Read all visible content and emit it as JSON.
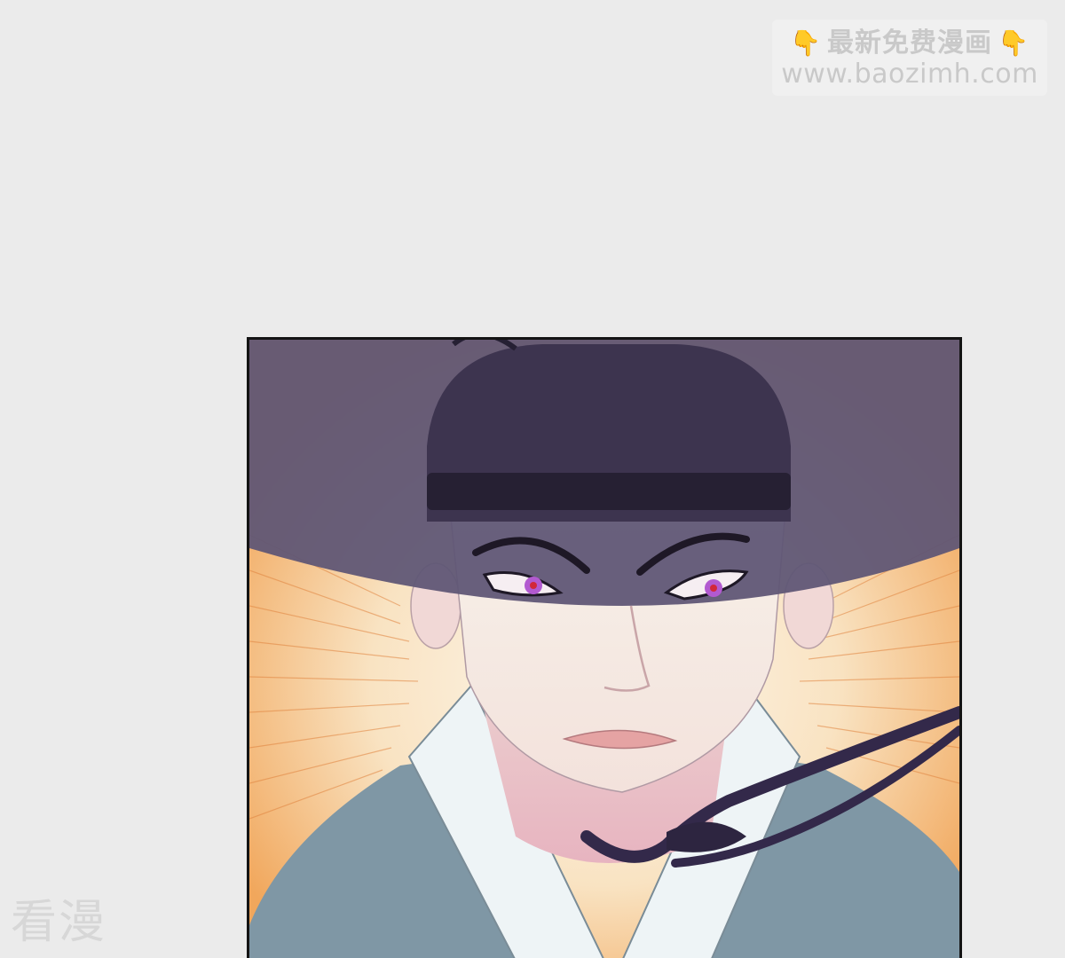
{
  "watermark_top": {
    "line1": "最新免费漫画",
    "line2": "www.baozimh.com",
    "hand_icon_left": "pointing-down-hand-icon",
    "hand_icon_right": "pointing-down-hand-icon"
  },
  "watermark_bottom": {
    "text": "看漫"
  },
  "colors": {
    "background": "#ebebeb",
    "hat": "#5f5675",
    "robe": "#7f97a5",
    "burst": "#f3b06b",
    "eyes": "#b25ad0"
  }
}
